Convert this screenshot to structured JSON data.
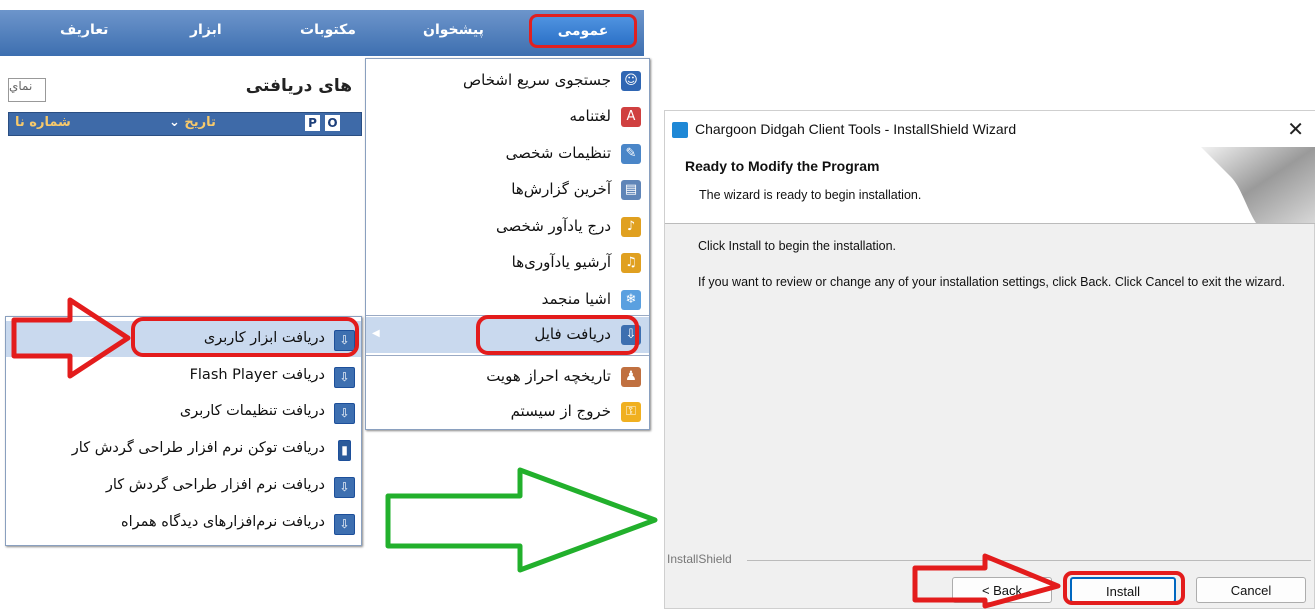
{
  "menubar": {
    "items": [
      "تعاریف",
      "ابزار",
      "مکتوبات",
      "پیشخوان",
      "عمومی"
    ]
  },
  "left_panel": {
    "title": "های دریافتی",
    "search_placeholder": "نماي",
    "columns": [
      "شماره نا",
      "تاریخ",
      "P",
      "O"
    ]
  },
  "menu": {
    "items": [
      {
        "label": "جستجوی سریع اشخاص",
        "icon": "person-search-icon"
      },
      {
        "label": "لغتنامه",
        "icon": "dictionary-icon"
      },
      {
        "label": "تنظیمات شخصی",
        "icon": "settings-icon"
      },
      {
        "label": "آخرین گزارش‌ها",
        "icon": "report-icon"
      },
      {
        "label": "درج یادآور شخصی",
        "icon": "bell-add-icon"
      },
      {
        "label": "آرشیو یادآوری‌ها",
        "icon": "bell-archive-icon"
      },
      {
        "label": "اشیا منجمد",
        "icon": "frozen-icon"
      },
      {
        "label": "دریافت فایل",
        "icon": "download-icon"
      },
      {
        "label": "تاریخچه احراز هویت",
        "icon": "auth-history-icon"
      },
      {
        "label": "خروج از سیستم",
        "icon": "logout-icon"
      }
    ]
  },
  "submenu": {
    "items": [
      {
        "label": "دریافت ابزار کاربری",
        "icon": "download-icon"
      },
      {
        "label": "دریافت Flash Player",
        "icon": "download-icon"
      },
      {
        "label": "دریافت تنظیمات کاربری",
        "icon": "download-icon"
      },
      {
        "label": "دریافت توکن نرم افزار طراحی گردش کار",
        "icon": "usb-token-icon"
      },
      {
        "label": "دریافت نرم افزار طراحی گردش کار",
        "icon": "download-icon"
      },
      {
        "label": "دریافت نرم‌افزارهای دیدگاه همراه",
        "icon": "download-icon"
      }
    ]
  },
  "wizard": {
    "title": "Chargoon Didgah Client Tools - InstallShield Wizard",
    "heading": "Ready to Modify the Program",
    "subheading": "The wizard is ready to begin installation.",
    "body1": "Click Install to begin the installation.",
    "body2": "If you want to review or change any of your installation settings, click Back. Click Cancel to exit the wizard.",
    "brand": "InstallShield",
    "back_label": "< Back",
    "install_label": "Install",
    "cancel_label": "Cancel",
    "close_glyph": "✕"
  },
  "colors": {
    "menubar": "#3d6fb0",
    "highlight": "#c9d9ee",
    "red_annotation": "#e31c1c",
    "green_annotation": "#22b02c"
  }
}
